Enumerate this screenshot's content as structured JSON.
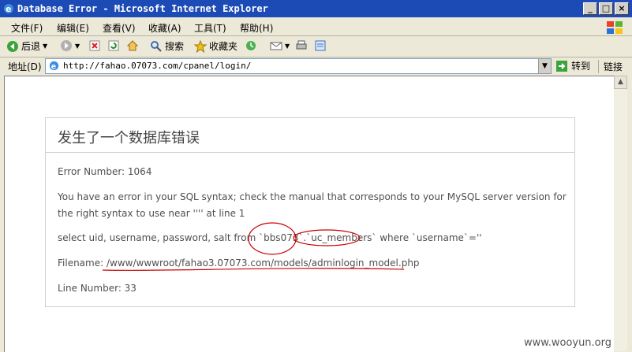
{
  "window": {
    "title": "Database Error - Microsoft Internet Explorer"
  },
  "menu": [
    "文件(F)",
    "编辑(E)",
    "查看(V)",
    "收藏(A)",
    "工具(T)",
    "帮助(H)"
  ],
  "toolbar": {
    "back": "后退",
    "search": "搜索",
    "favorites": "收藏夹"
  },
  "address": {
    "label": "地址(D)",
    "url": "http://fahao.07073.com/cpanel/login/",
    "go": "转到",
    "links": "链接"
  },
  "error": {
    "heading": "发生了一个数据库错误",
    "number": "Error Number: 1064",
    "message1": "You have an error in your SQL syntax; check the manual that corresponds to your MySQL server version for",
    "message2": "the right syntax to use near '''' at line 1",
    "query": "select uid, username, password, salt from `bbs073`.`uc_members` where `username`=''",
    "filename": "Filename: /www/wwwroot/fahao3.07073.com/models/adminlogin_model.php",
    "line": "Line Number: 33"
  },
  "watermark": "www.wooyun.org",
  "colors": {
    "titlebar": "#1d4bb5",
    "annotation": "#cc0000"
  }
}
